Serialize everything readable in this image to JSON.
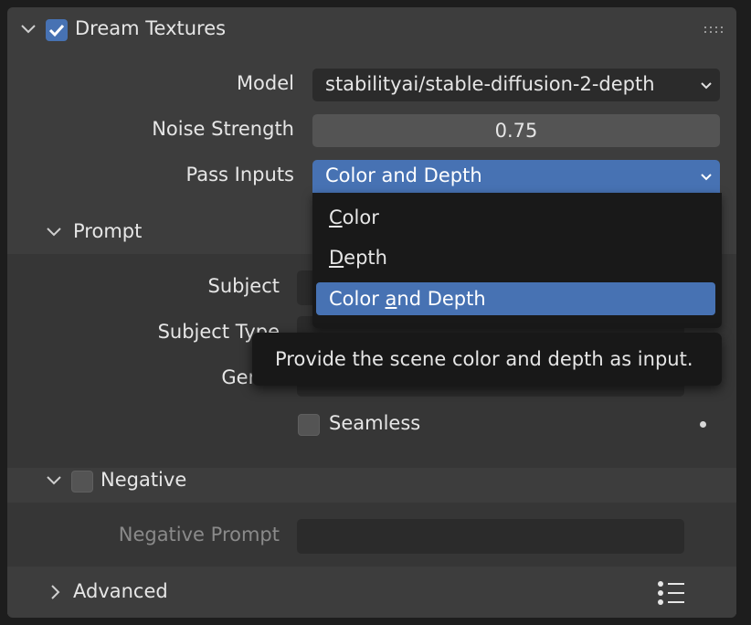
{
  "panel": {
    "title": "Dream Textures",
    "enabled": true
  },
  "model": {
    "label": "Model",
    "value": "stabilityai/stable-diffusion-2-depth"
  },
  "noise_strength": {
    "label": "Noise Strength",
    "value": "0.75"
  },
  "pass_inputs": {
    "label": "Pass Inputs",
    "value": "Color and Depth",
    "options": [
      {
        "pre": "",
        "key": "C",
        "post": "olor"
      },
      {
        "pre": "",
        "key": "D",
        "post": "epth"
      },
      {
        "pre": "Color ",
        "key": "a",
        "post": "nd Depth"
      }
    ],
    "tooltip": "Provide the scene color and depth as input."
  },
  "prompt": {
    "title": "Prompt",
    "subject_label": "Subject",
    "subject_type_label": "Subject Type",
    "genre_label": "Genre",
    "seamless_label": "Seamless"
  },
  "negative": {
    "title": "Negative",
    "enabled": false,
    "prompt_label": "Negative Prompt"
  },
  "advanced": {
    "title": "Advanced"
  },
  "colors": {
    "accent": "#4772b3",
    "panel": "#3d3d3d",
    "field": "#2b2b2b"
  }
}
